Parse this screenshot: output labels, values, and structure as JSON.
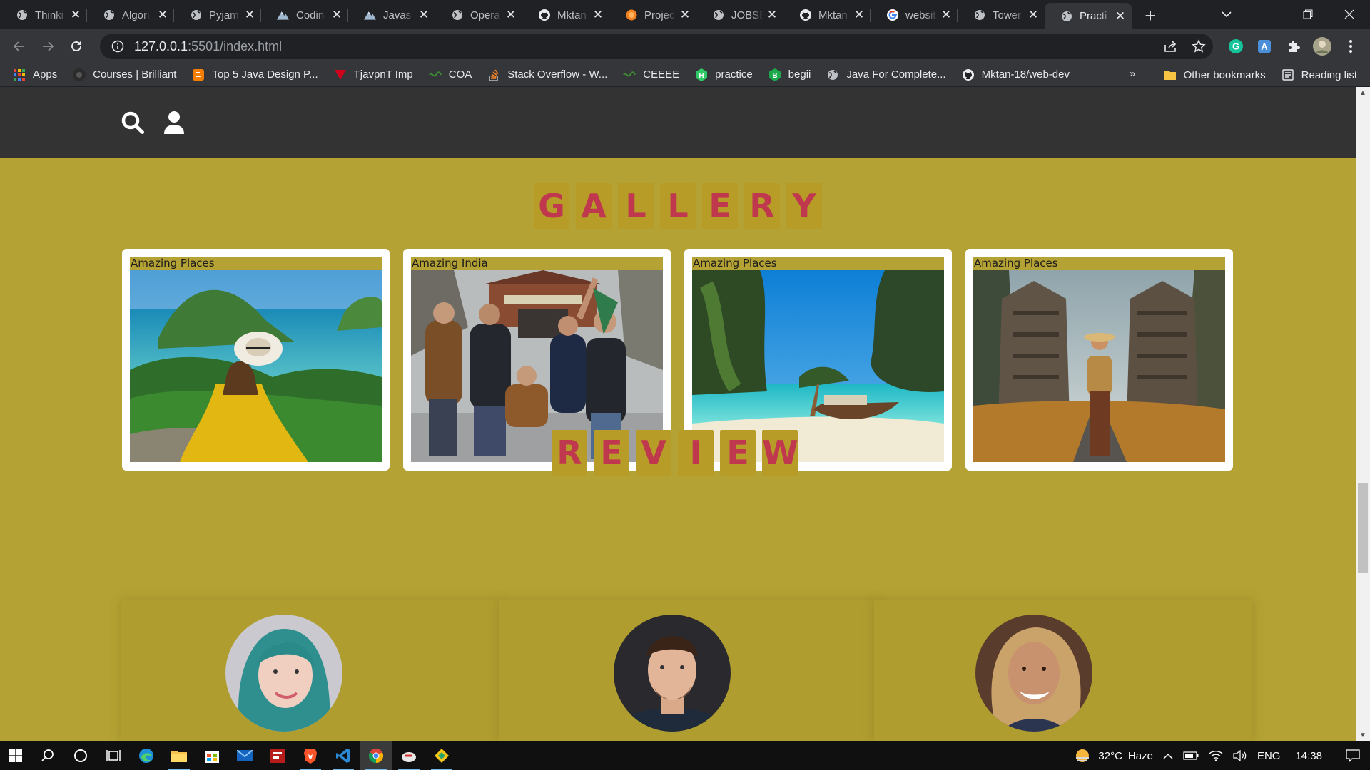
{
  "browser": {
    "tabs": [
      {
        "title": "Thinki",
        "favicon": "globe-icon"
      },
      {
        "title": "Algori",
        "favicon": "globe-icon"
      },
      {
        "title": "Pyjam",
        "favicon": "globe-icon"
      },
      {
        "title": "Codin",
        "favicon": "mountain-icon"
      },
      {
        "title": "Javas",
        "favicon": "mountain-icon"
      },
      {
        "title": "Opera",
        "favicon": "globe-icon"
      },
      {
        "title": "Mktan",
        "favicon": "github-icon"
      },
      {
        "title": "Projec",
        "favicon": "orange-circle-icon"
      },
      {
        "title": "JOBSE",
        "favicon": "globe-icon"
      },
      {
        "title": "Mktan",
        "favicon": "github-icon"
      },
      {
        "title": "websit",
        "favicon": "google-icon"
      },
      {
        "title": "Tower",
        "favicon": "globe-icon"
      },
      {
        "title": "Practi",
        "favicon": "globe-icon",
        "active": true
      }
    ],
    "url_host": "127.0.0.1",
    "url_path": ":5501/index.html",
    "bookmarks": [
      {
        "label": "Apps",
        "icon": "apps-grid-icon"
      },
      {
        "label": "Courses | Brilliant",
        "icon": "brilliant-icon"
      },
      {
        "label": "Top 5 Java Design P...",
        "icon": "blogger-icon"
      },
      {
        "label": "TjavpnT Imp",
        "icon": "vpn-icon"
      },
      {
        "label": "COA",
        "icon": "link-icon"
      },
      {
        "label": "Stack Overflow - W...",
        "icon": "stackoverflow-icon"
      },
      {
        "label": "CEEEE",
        "icon": "link-icon"
      },
      {
        "label": "practice",
        "icon": "hackerrank-icon"
      },
      {
        "label": "begii",
        "icon": "b-icon"
      },
      {
        "label": "Java For Complete...",
        "icon": "globe-icon"
      },
      {
        "label": "Mktan-18/web-dev",
        "icon": "github-icon"
      }
    ],
    "bookmarks_more": "»",
    "other_bookmarks": "Other bookmarks",
    "reading_list": "Reading list"
  },
  "page": {
    "gallery_heading": [
      "G",
      "A",
      "L",
      "L",
      "E",
      "R",
      "Y"
    ],
    "review_heading": [
      "R",
      "E",
      "V",
      "I",
      "E",
      "W"
    ],
    "gallery": [
      {
        "caption": "Amazing Places",
        "image": "woman-in-yellow-dress-island-view"
      },
      {
        "caption": "Amazing India",
        "image": "group-of-friends-at-tunnel"
      },
      {
        "caption": "Amazing Places",
        "image": "longtail-boat-beach-cliffs"
      },
      {
        "caption": "Amazing Places",
        "image": "traveler-at-temple-gate"
      }
    ],
    "reviewers": [
      {
        "avatar": "woman-teal-hair-avatar"
      },
      {
        "avatar": "man-portrait-avatar"
      },
      {
        "avatar": "smiling-woman-avatar"
      }
    ]
  },
  "taskbar": {
    "weather_temp": "32°C",
    "weather_text": "Haze",
    "language": "ENG",
    "time": "14:38"
  }
}
